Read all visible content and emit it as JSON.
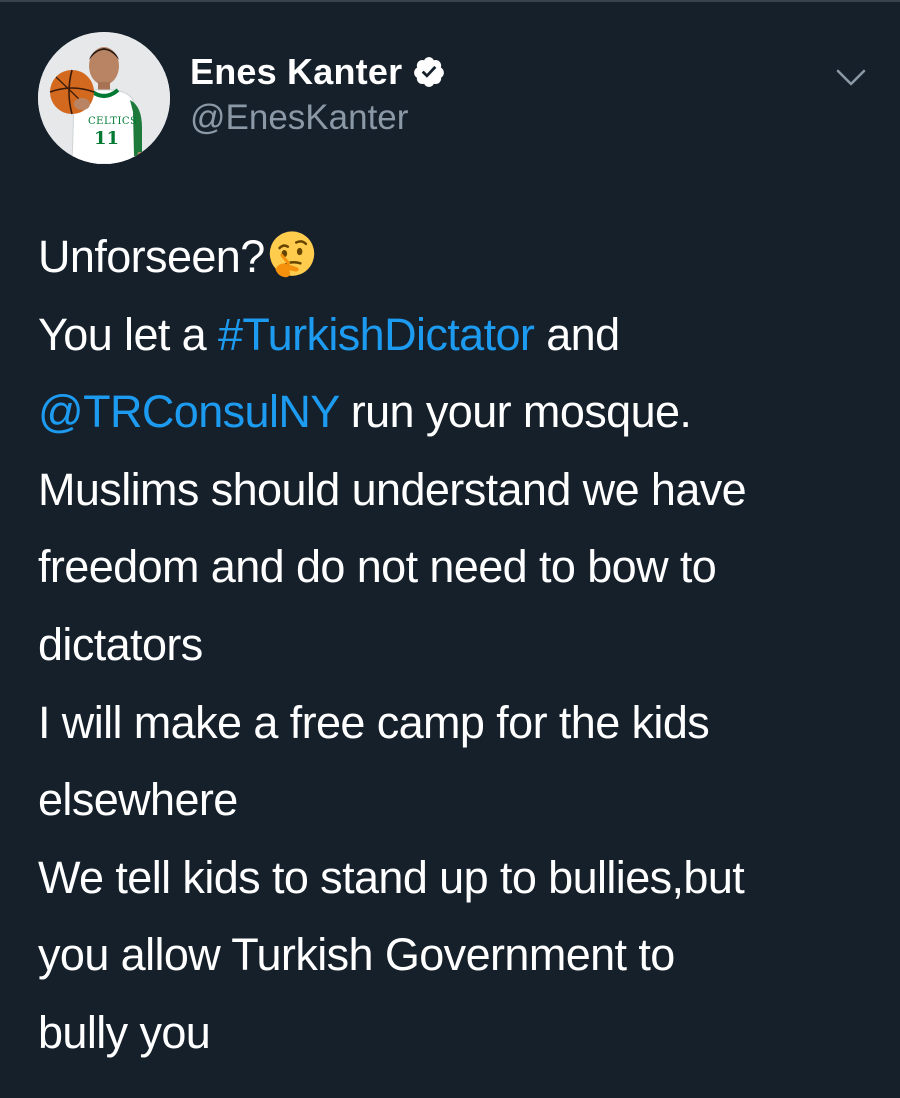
{
  "author": {
    "display_name": "Enes Kanter",
    "handle": "@EnesKanter",
    "verified": true,
    "avatar_jersey_text": "CELTICS",
    "avatar_jersey_number": "11"
  },
  "tweet": {
    "lines": [
      [
        {
          "text": "Unforseen?",
          "type": "text"
        },
        {
          "emoji": "thinking-face"
        }
      ],
      [
        {
          "text": "You let a ",
          "type": "text"
        },
        {
          "text": "#TurkishDictator",
          "type": "hashtag"
        },
        {
          "text": " and",
          "type": "text"
        }
      ],
      [
        {
          "text": "@TRConsulNY",
          "type": "mention"
        },
        {
          "text": " run your mosque.",
          "type": "text"
        }
      ],
      [
        {
          "text": "Muslims should understand we have",
          "type": "text"
        }
      ],
      [
        {
          "text": "freedom and do not need to bow to",
          "type": "text"
        }
      ],
      [
        {
          "text": "dictators",
          "type": "text"
        }
      ],
      [
        {
          "text": "I will make a free camp for the kids",
          "type": "text"
        }
      ],
      [
        {
          "text": "elsewhere",
          "type": "text"
        }
      ],
      [
        {
          "text": "We tell kids to stand up to bullies,but",
          "type": "text"
        }
      ],
      [
        {
          "text": "you allow Turkish Government to",
          "type": "text"
        }
      ],
      [
        {
          "text": "bully you",
          "type": "text"
        }
      ]
    ]
  },
  "colors": {
    "background": "#15202b",
    "text": "#ffffff",
    "secondary_text": "#8b98a5",
    "link": "#1d9bf0"
  },
  "icons": {
    "verified": "verified-badge-icon",
    "menu": "chevron-down-icon",
    "emoji": "thinking-face-emoji"
  }
}
